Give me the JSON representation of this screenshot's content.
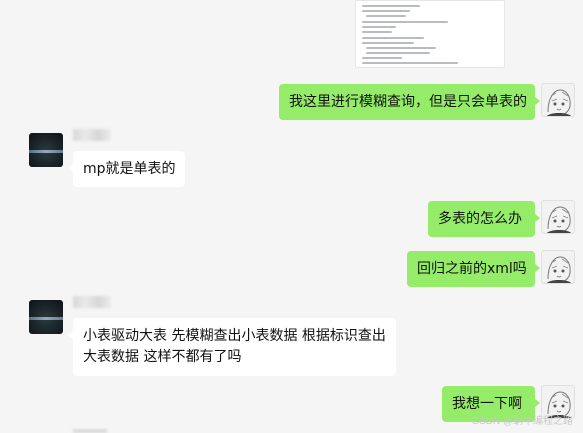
{
  "messages": [
    {
      "sender": "me",
      "text": "我这里进行模糊查询，但是只会单表的"
    },
    {
      "sender": "other",
      "text": "mp就是单表的"
    },
    {
      "sender": "me",
      "text": "多表的怎么办"
    },
    {
      "sender": "me",
      "text": "回归之前的xml吗"
    },
    {
      "sender": "other",
      "text": "小表驱动大表 先模糊查出小表数据 根据标识查出大表数据 这样不都有了吗"
    },
    {
      "sender": "me",
      "text": "我想一下啊"
    }
  ],
  "watermark": "CSDN @蜗牛编程之路",
  "colors": {
    "background": "#f5f5f5",
    "my_bubble": "#95ec69",
    "other_bubble": "#ffffff"
  }
}
